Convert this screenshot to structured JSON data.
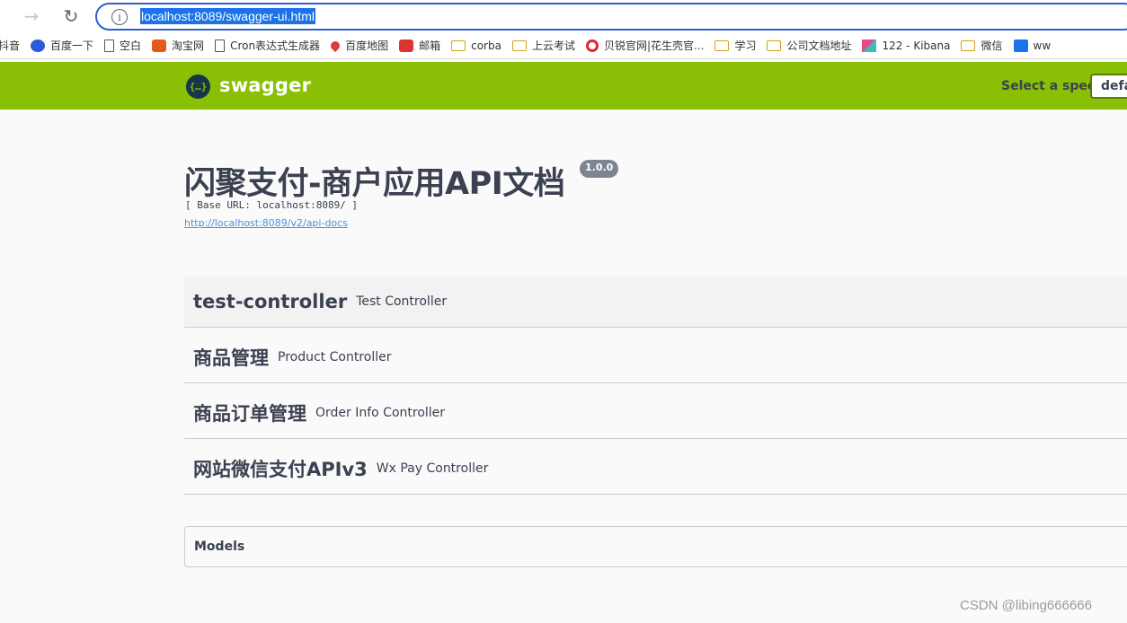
{
  "browser": {
    "url": "localhost:8089/swagger-ui.html",
    "bookmarks": [
      {
        "label": "抖音",
        "icon": "douyin-icon"
      },
      {
        "label": "百度一下",
        "icon": "baidu-icon"
      },
      {
        "label": "空白",
        "icon": "page-icon"
      },
      {
        "label": "淘宝网",
        "icon": "taobao-icon"
      },
      {
        "label": "Cron表达式生成器",
        "icon": "page-icon"
      },
      {
        "label": "百度地图",
        "icon": "map-pin-icon"
      },
      {
        "label": "邮箱",
        "icon": "mail-icon"
      },
      {
        "label": "corba",
        "icon": "folder-icon"
      },
      {
        "label": "上云考试",
        "icon": "folder-icon"
      },
      {
        "label": "贝锐官网|花生壳官...",
        "icon": "peanut-icon"
      },
      {
        "label": "学习",
        "icon": "folder-icon"
      },
      {
        "label": "公司文档地址",
        "icon": "folder-icon"
      },
      {
        "label": "122 - Kibana",
        "icon": "kibana-icon"
      },
      {
        "label": "微信",
        "icon": "folder-icon"
      },
      {
        "label": "ww",
        "icon": "wave-icon"
      }
    ]
  },
  "topbar": {
    "logo_symbol": "{…}",
    "logo_text": "swagger",
    "spec_label": "Select a spec",
    "spec_value": "default"
  },
  "info": {
    "title": "闪聚支付-商户应用API文档",
    "version": "1.0.0",
    "base_url": "[ Base URL: localhost:8089/ ]",
    "api_docs_link": "http://localhost:8089/v2/api-docs"
  },
  "tags": [
    {
      "name": "test-controller",
      "description": "Test Controller"
    },
    {
      "name": "商品管理",
      "description": "Product Controller"
    },
    {
      "name": "商品订单管理",
      "description": "Order Info Controller"
    },
    {
      "name": "网站微信支付APIv3",
      "description": "Wx Pay Controller"
    }
  ],
  "models": {
    "label": "Models"
  },
  "watermark": "CSDN @libing666666",
  "colors": {
    "topbar": "#89bf04",
    "text": "#3b4151",
    "link": "#4990e2"
  }
}
